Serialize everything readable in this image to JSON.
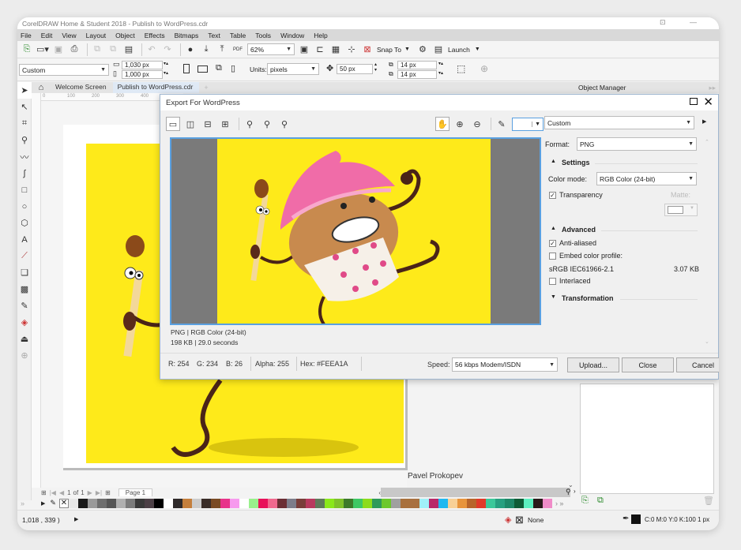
{
  "app": {
    "title": "CorelDRAW Home & Student 2018 - Publish to WordPress.cdr"
  },
  "menu": [
    "File",
    "Edit",
    "View",
    "Layout",
    "Object",
    "Effects",
    "Bitmaps",
    "Text",
    "Table",
    "Tools",
    "Window",
    "Help"
  ],
  "toolbar": {
    "zoom_level": "62%",
    "snap_to_label": "Snap To",
    "launch_label": "Launch"
  },
  "property_bar": {
    "page_preset": "Custom",
    "width": "1,030 px",
    "height": "1,000 px",
    "units_label": "Units:",
    "units_value": "pixels",
    "nudge": "50 px",
    "dup_x": "14 px",
    "dup_y": "14 px"
  },
  "tabs": [
    {
      "label": "Welcome Screen",
      "active": false
    },
    {
      "label": "Publish to WordPress.cdr",
      "active": true
    }
  ],
  "ruler": {
    "h_ticks": [
      "0",
      "100",
      "200",
      "300",
      "400"
    ]
  },
  "docker": {
    "title": "Object Manager"
  },
  "canvas": {
    "author": "Pavel Prokopev",
    "artwork_color": "#feea1a"
  },
  "page_nav": {
    "current": "1",
    "of_label": "of",
    "total": "1",
    "page_tab": "Page 1"
  },
  "palette": [
    "#e8e8e8",
    "#1a1a1a",
    "#9a9a9a",
    "#6e6e6e",
    "#555555",
    "#b0b0b0",
    "#7c7c7c",
    "#3a3a3a",
    "#4c4046",
    "#000000",
    "#ffffff",
    "#2f2a2a",
    "#c47f3c",
    "#cccccc",
    "#3a2d28",
    "#7a4a24",
    "#e8338a",
    "#f79aee",
    "#ffffff",
    "#99f08c",
    "#e8115a",
    "#f0698e",
    "#6b2e34",
    "#7d7d8a",
    "#7a3e3a",
    "#b83a5e",
    "#5f7a5a",
    "#8ae81a",
    "#7ec22a",
    "#3c7a2a",
    "#3ec864",
    "#8cdc1c",
    "#2e9a5a",
    "#6cc82c",
    "#a0a0a0",
    "#a8703c",
    "#a87040",
    "#a0f0f8",
    "#b82868",
    "#20b8f0",
    "#f8d096",
    "#e8943c",
    "#b8642a",
    "#e03a2a",
    "#3cc89a",
    "#28a080",
    "#1e8868",
    "#0e5c36",
    "#5cf0c0",
    "#2a1a1a",
    "#f08cc8"
  ],
  "statusbar": {
    "coords": "1,018 , 339 )",
    "fill_label": "None",
    "outline_label": "C:0 M:0 Y:0 K:100  1 px"
  },
  "dialog": {
    "title": "Export For WordPress",
    "preset": "Custom",
    "format_label": "Format:",
    "format_value": "PNG",
    "settings_label": "Settings",
    "color_mode_label": "Color mode:",
    "color_mode_value": "RGB Color (24-bit)",
    "transparency_label": "Transparency",
    "transparency_checked": true,
    "matte_label": "Matte:",
    "advanced_label": "Advanced",
    "anti_aliased_label": "Anti-aliased",
    "anti_aliased_checked": true,
    "embed_profile_label": "Embed color profile:",
    "embed_profile_checked": false,
    "profile_name": "sRGB IEC61966-2.1",
    "profile_size": "3.07 KB",
    "interlaced_label": "Interlaced",
    "interlaced_checked": false,
    "transformation_label": "Transformation",
    "preview_info_line1": "PNG  |  RGB Color (24-bit)",
    "preview_info_line2": "198 KB  |  29.0 seconds",
    "r": "R: 254",
    "g": "G: 234",
    "b": "B: 26",
    "alpha": "Alpha: 255",
    "hex": "Hex: #FEEA1A",
    "speed_label": "Speed:",
    "speed_value": "56 kbps Modem/ISDN",
    "upload_label": "Upload...",
    "close_label": "Close",
    "cancel_label": "Cancel",
    "preview_bg": "#feea1a"
  }
}
